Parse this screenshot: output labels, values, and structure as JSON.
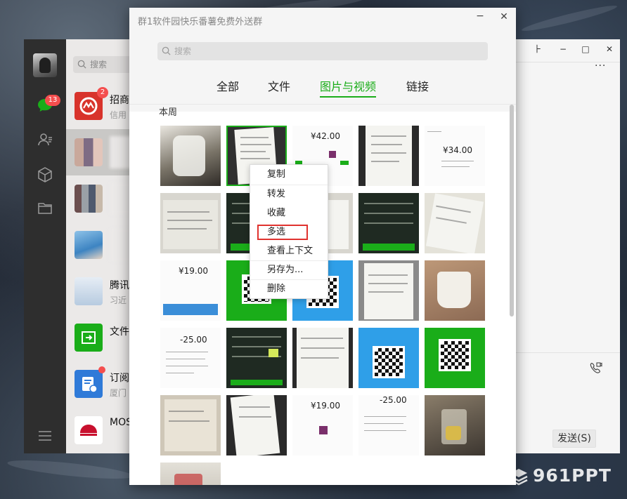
{
  "wechat": {
    "unread_count": "13",
    "search_placeholder": "搜索",
    "chats": [
      {
        "name": "招商",
        "sub": "信用",
        "badge": "2"
      },
      {
        "name": "",
        "sub": ""
      },
      {
        "name": "",
        "sub": ""
      },
      {
        "name": "",
        "sub": ""
      },
      {
        "name": "腾讯",
        "sub": "习近"
      },
      {
        "name": "文件",
        "sub": ""
      },
      {
        "name": "订阅",
        "sub": "厦门"
      },
      {
        "name": "MOS",
        "sub": ""
      }
    ],
    "window_controls": {
      "pin": "⺊",
      "minimize": "−",
      "maximize": "□",
      "close": "✕"
    },
    "more_label": "···",
    "send_label": "发送(S)"
  },
  "popup": {
    "title": "群1软件园快乐番薯免费外送群",
    "minimize_label": "−",
    "close_label": "✕",
    "search_placeholder": "搜索",
    "tabs": [
      "全部",
      "文件",
      "图片与视频",
      "链接"
    ],
    "active_tab": "图片与视频",
    "section_label": "本周",
    "thumb_amounts": {
      "t3": "¥42.00",
      "t5": "¥34.00",
      "t11": "¥19.00",
      "t16": "-25.00",
      "t23": "¥19.00",
      "t24": "-25.00"
    }
  },
  "context_menu": {
    "items": [
      "复制",
      "转发",
      "收藏",
      "多选",
      "查看上下文",
      "另存为...",
      "删除"
    ],
    "highlighted": "多选"
  },
  "watermark": {
    "text": "961PPT"
  },
  "colors": {
    "accent_green": "#1aad19",
    "badge_red": "#f44e4e",
    "highlight_red": "#e0332f"
  }
}
